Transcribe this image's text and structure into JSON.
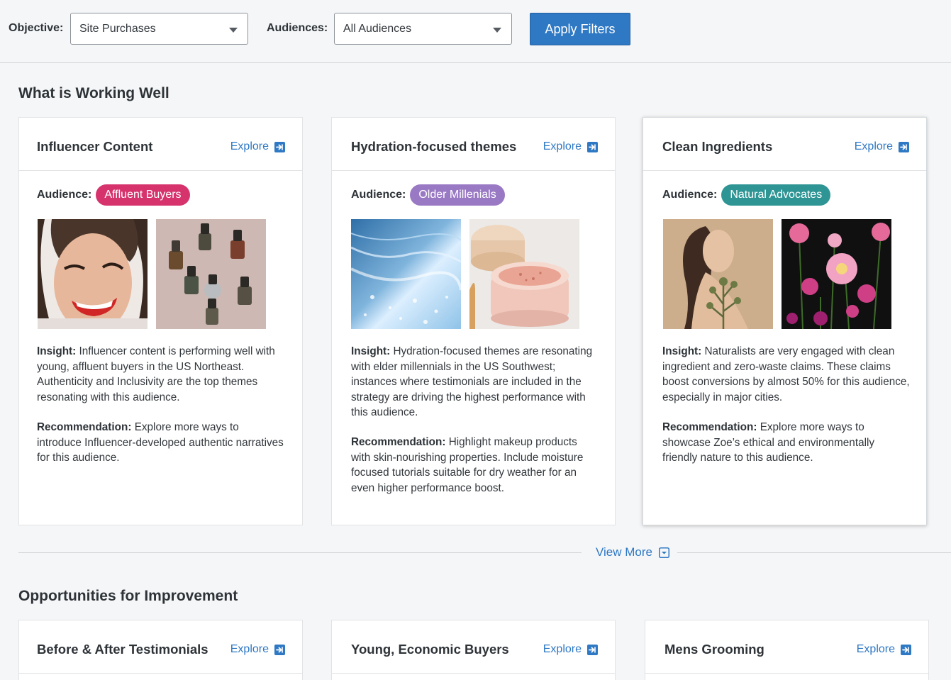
{
  "filters": {
    "objective_label": "Objective:",
    "objective_value": "Site Purchases",
    "audiences_label": "Audiences:",
    "audiences_value": "All Audiences",
    "apply_label": "Apply Filters"
  },
  "sections": {
    "working_well_title": "What is Working Well",
    "improvement_title": "Opportunities for Improvement",
    "view_more_label": "View More"
  },
  "working_cards": [
    {
      "title": "Influencer Content",
      "explore": "Explore",
      "audience_label": "Audience:",
      "audience": "Affluent Buyers",
      "badge_color": "#d6336c",
      "insight_label": "Insight:",
      "insight": "Influencer content is performing well with young, affluent buyers in the US Northeast. Authenticity and Inclusivity are the top themes resonating with this audience.",
      "rec_label": "Recommendation:",
      "recommendation": "Explore more ways to introduce Influencer-developed authentic narratives for this audience."
    },
    {
      "title": "Hydration-focused themes",
      "explore": "Explore",
      "audience_label": "Audience:",
      "audience": "Older Millenials",
      "badge_color": "#9a79c4",
      "insight_label": "Insight:",
      "insight": "Hydration-focused themes are resonating with elder millennials in the US Southwest; instances where testimonials are included in the strategy are driving the highest performance with this audience.",
      "rec_label": "Recommendation:",
      "recommendation": "Highlight makeup products with skin-nourishing properties. Include moisture focused tutorials suitable for dry weather for an even higher performance boost."
    },
    {
      "title": "Clean Ingredients",
      "explore": "Explore",
      "audience_label": "Audience:",
      "audience": "Natural Advocates",
      "badge_color": "#2f9494",
      "insight_label": "Insight:",
      "insight": "Naturalists are very engaged with clean ingredient and zero-waste claims. These claims boost conversions by almost 50% for this audience, especially in major cities.",
      "rec_label": "Recommendation:",
      "recommendation": "Explore more ways to showcase Zoe’s ethical and environmentally friendly nature to this audience."
    }
  ],
  "improvement_cards": [
    {
      "title": "Before & After Testimonials",
      "explore": "Explore"
    },
    {
      "title": "Young, Economic Buyers",
      "explore": "Explore"
    },
    {
      "title": "Mens Grooming",
      "explore": "Explore"
    }
  ],
  "colors": {
    "accent": "#2f78c4",
    "page_bg": "#f5f6f7"
  }
}
